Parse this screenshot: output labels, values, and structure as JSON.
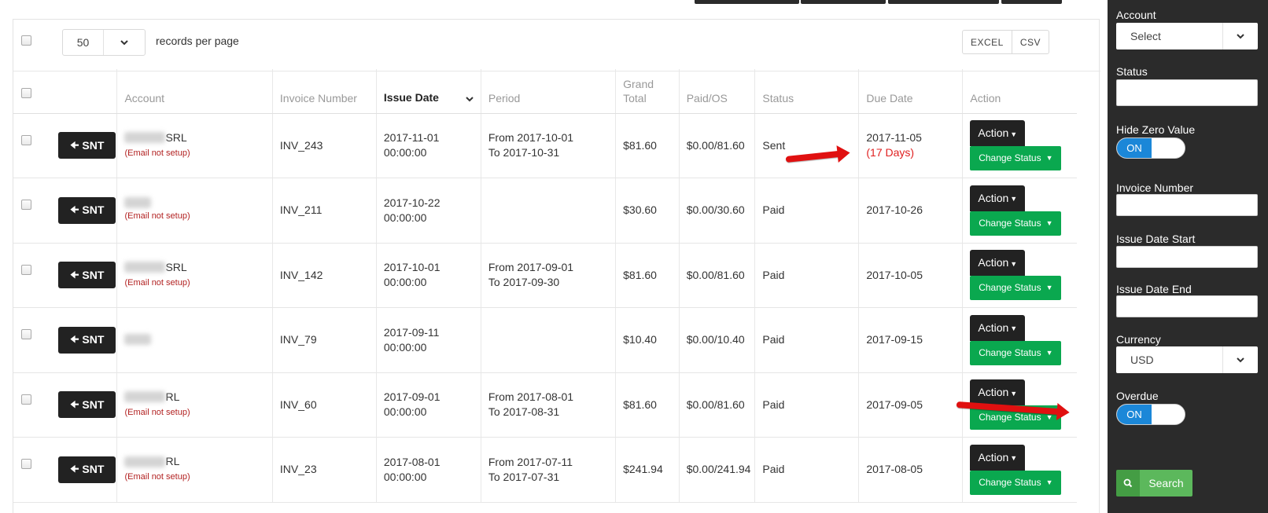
{
  "toolbar": {
    "per_page_value": "50",
    "records_label": "records per page",
    "export_excel": "EXCEL",
    "export_csv": "CSV"
  },
  "table": {
    "headers": {
      "account": "Account",
      "invoice_number": "Invoice Number",
      "issue_date": "Issue Date",
      "period": "Period",
      "grand_total": "Grand Total",
      "paid_os": "Paid/OS",
      "status": "Status",
      "due_date": "Due Date",
      "action": "Action"
    },
    "snt_label": "SNT",
    "action_label": "Action",
    "change_status_label": "Change Status",
    "rows": [
      {
        "account_suffix": "SRL",
        "email_note": "(Email not setup)",
        "invoice": "INV_243",
        "issue_date": "2017-11-01",
        "issue_time": "00:00:00",
        "period_from": "From 2017-10-01",
        "period_to": "To 2017-10-31",
        "grand_total": "$81.60",
        "paid_os": "$0.00/81.60",
        "status": "Sent",
        "due_date": "2017-11-05",
        "due_note": "(17 Days)"
      },
      {
        "account_suffix": "",
        "email_note": "(Email not setup)",
        "invoice": "INV_211",
        "issue_date": "2017-10-22",
        "issue_time": "00:00:00",
        "period_from": "",
        "period_to": "",
        "grand_total": "$30.60",
        "paid_os": "$0.00/30.60",
        "status": "Paid",
        "due_date": "2017-10-26",
        "due_note": ""
      },
      {
        "account_suffix": "SRL",
        "email_note": "(Email not setup)",
        "invoice": "INV_142",
        "issue_date": "2017-10-01",
        "issue_time": "00:00:00",
        "period_from": "From 2017-09-01",
        "period_to": "To 2017-09-30",
        "grand_total": "$81.60",
        "paid_os": "$0.00/81.60",
        "status": "Paid",
        "due_date": "2017-10-05",
        "due_note": ""
      },
      {
        "account_suffix": "",
        "email_note": "",
        "invoice": "INV_79",
        "issue_date": "2017-09-11",
        "issue_time": "00:00:00",
        "period_from": "",
        "period_to": "",
        "grand_total": "$10.40",
        "paid_os": "$0.00/10.40",
        "status": "Paid",
        "due_date": "2017-09-15",
        "due_note": ""
      },
      {
        "account_suffix": "RL",
        "email_note": "(Email not setup)",
        "invoice": "INV_60",
        "issue_date": "2017-09-01",
        "issue_time": "00:00:00",
        "period_from": "From 2017-08-01",
        "period_to": "To 2017-08-31",
        "grand_total": "$81.60",
        "paid_os": "$0.00/81.60",
        "status": "Paid",
        "due_date": "2017-09-05",
        "due_note": ""
      },
      {
        "account_suffix": "RL",
        "email_note": "(Email not setup)",
        "invoice": "INV_23",
        "issue_date": "2017-08-01",
        "issue_time": "00:00:00",
        "period_from": "From 2017-07-11",
        "period_to": "To 2017-07-31",
        "grand_total": "$241.94",
        "paid_os": "$0.00/241.94",
        "status": "Paid",
        "due_date": "2017-08-05",
        "due_note": ""
      }
    ]
  },
  "filters": {
    "account_label": "Account",
    "account_value": "Select",
    "status_label": "Status",
    "status_value": "",
    "hide_zero_label": "Hide Zero Value",
    "hide_zero_state": "ON",
    "invoice_number_label": "Invoice Number",
    "issue_start_label": "Issue Date Start",
    "issue_end_label": "Issue Date End",
    "currency_label": "Currency",
    "currency_value": "USD",
    "overdue_label": "Overdue",
    "overdue_state": "ON",
    "search_label": "Search"
  },
  "colors": {
    "accent_toggle": "#1b87d8",
    "change_status": "#0aa84f",
    "search": "#5cb85c",
    "overdue_text": "#e02020",
    "annotation_arrow": "#e01010"
  }
}
